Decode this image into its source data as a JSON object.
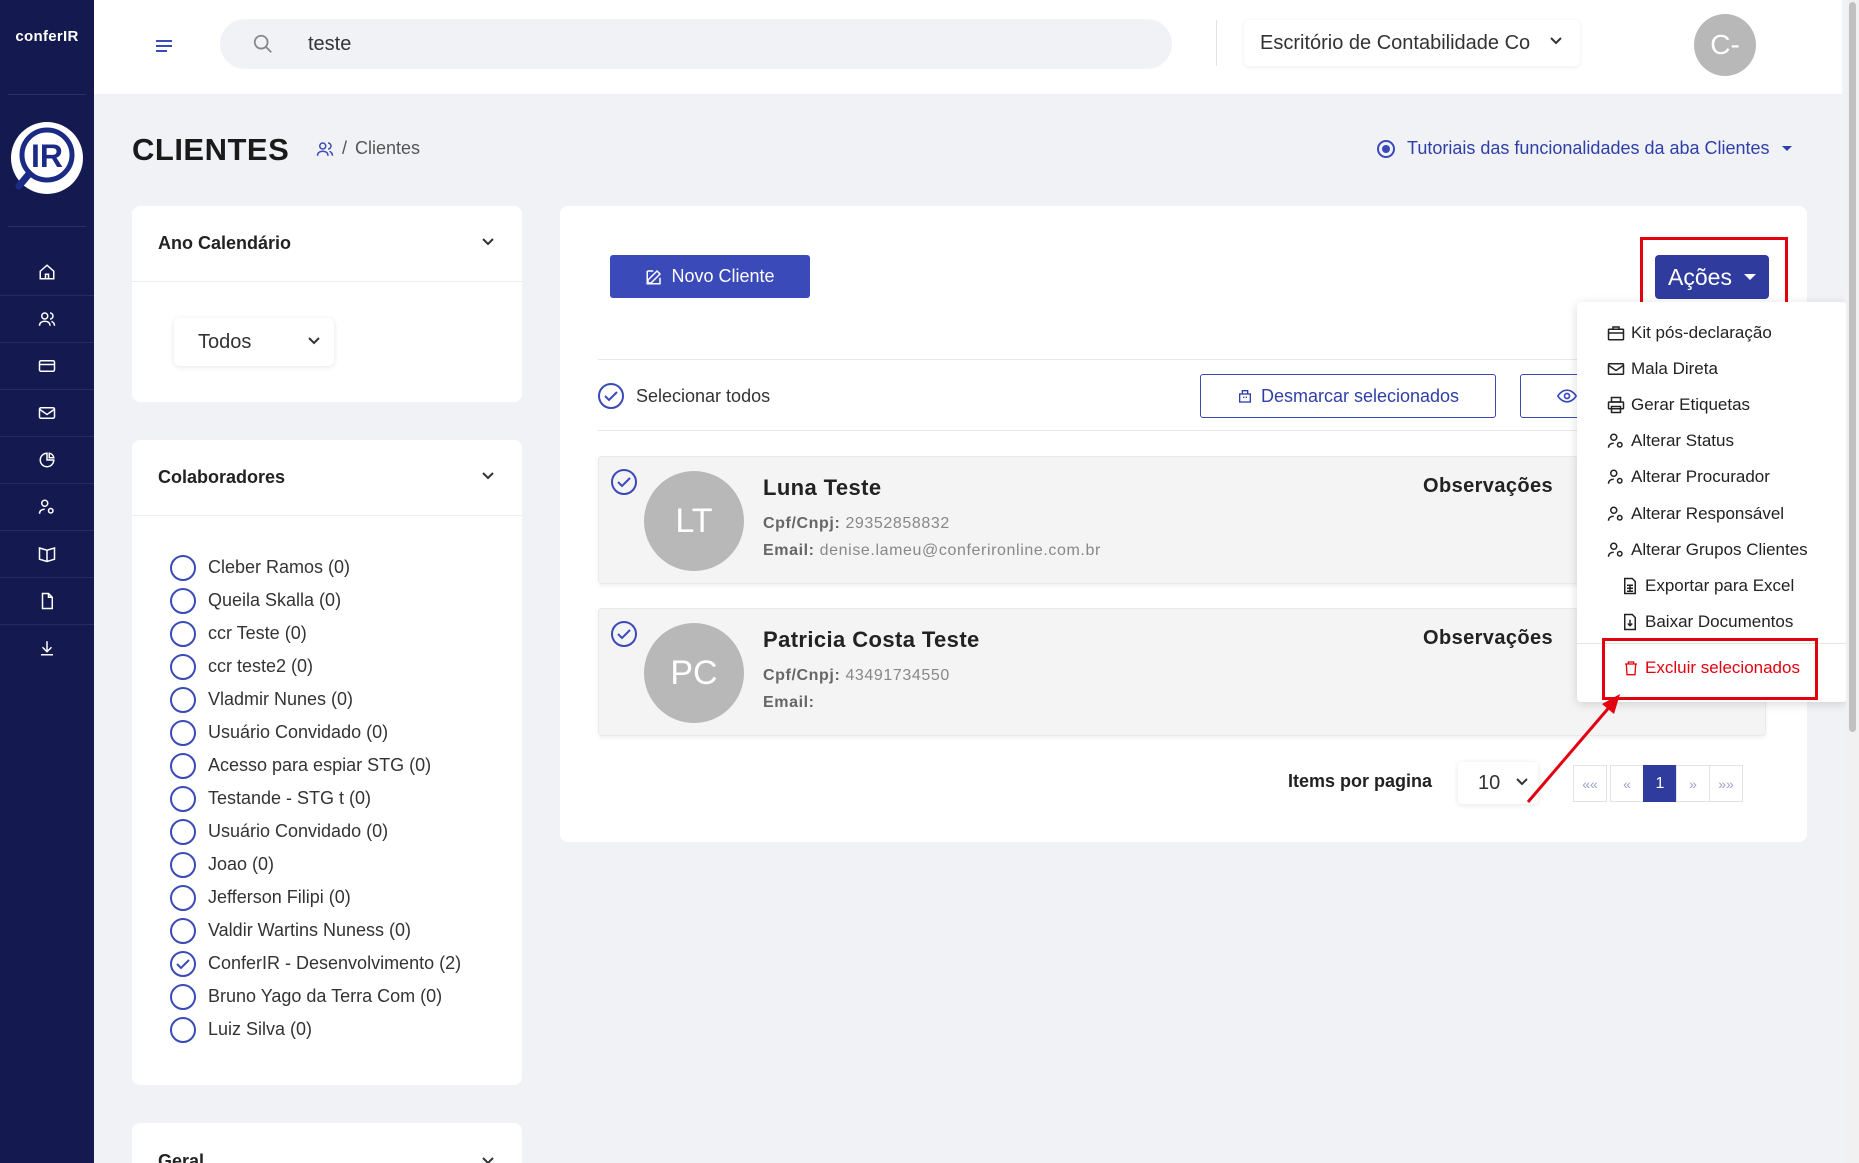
{
  "sidebar": {
    "brand_text": "conferIR",
    "logo_text": "IR",
    "nav": [
      {
        "id": "home",
        "icon": "home-icon"
      },
      {
        "id": "clientes",
        "icon": "users-icon"
      },
      {
        "id": "cards",
        "icon": "credit-card-icon"
      },
      {
        "id": "mail",
        "icon": "mail-icon"
      },
      {
        "id": "reports",
        "icon": "pie-chart-icon"
      },
      {
        "id": "user-settings",
        "icon": "user-gear-icon"
      },
      {
        "id": "book",
        "icon": "book-icon"
      },
      {
        "id": "documents",
        "icon": "document-icon"
      },
      {
        "id": "download",
        "icon": "download-icon"
      }
    ]
  },
  "topbar": {
    "search_value": "teste",
    "office_select": "Escritório de Contabilidade Co",
    "avatar_initials": "C-"
  },
  "header": {
    "title": "CLIENTES",
    "breadcrumb_sep": "/",
    "breadcrumb_current": "Clientes",
    "tutorials_label": "Tutoriais das funcionalidades da aba Clientes"
  },
  "filters": {
    "ano": {
      "title": "Ano Calendário",
      "selected": "Todos"
    },
    "colaboradores": {
      "title": "Colaboradores",
      "items": [
        {
          "label": "Cleber Ramos (0)",
          "checked": false
        },
        {
          "label": "Queila Skalla (0)",
          "checked": false
        },
        {
          "label": "ccr Teste (0)",
          "checked": false
        },
        {
          "label": "ccr teste2 (0)",
          "checked": false
        },
        {
          "label": "Vladmir Nunes (0)",
          "checked": false
        },
        {
          "label": "Usuário Convidado (0)",
          "checked": false
        },
        {
          "label": "Acesso para espiar STG (0)",
          "checked": false
        },
        {
          "label": "Testande - STG t (0)",
          "checked": false
        },
        {
          "label": "Usuário Convidado (0)",
          "checked": false
        },
        {
          "label": "Joao (0)",
          "checked": false
        },
        {
          "label": "Jefferson Filipi (0)",
          "checked": false
        },
        {
          "label": "Valdir Wartins Nuness (0)",
          "checked": false
        },
        {
          "label": "ConferIR - Desenvolvimento (2)",
          "checked": true
        },
        {
          "label": "Bruno Yago da Terra Com (0)",
          "checked": false
        },
        {
          "label": "Luiz Silva (0)",
          "checked": false
        }
      ]
    },
    "geral": {
      "title": "Geral"
    }
  },
  "toolbar": {
    "novo_cliente": "Novo Cliente",
    "acoes": "Ações",
    "selecionar_todos": "Selecionar todos",
    "desmarcar": "Desmarcar selecionados"
  },
  "clients": [
    {
      "initials": "LT",
      "name": "Luna Teste",
      "cpf_label": "Cpf/Cnpj:",
      "cpf": "29352858832",
      "email_label": "Email:",
      "email": "denise.lameu@conferironline.com.br",
      "obs_label": "Observações"
    },
    {
      "initials": "PC",
      "name": "Patricia Costa Teste",
      "cpf_label": "Cpf/Cnpj:",
      "cpf": "43491734550",
      "email_label": "Email:",
      "email": "",
      "obs_label": "Observações"
    }
  ],
  "pagination": {
    "items_label": "Items por pagina",
    "page_size": "10",
    "first": "««",
    "prev": "«",
    "current": "1",
    "next": "»",
    "last": "»»"
  },
  "actions_menu": {
    "items": [
      {
        "label": "Kit pós-declaração",
        "icon": "briefcase-icon"
      },
      {
        "label": "Mala Direta",
        "icon": "mail-send-icon"
      },
      {
        "label": "Gerar Etiquetas",
        "icon": "printer-icon"
      },
      {
        "label": "Alterar Status",
        "icon": "user-gear-icon"
      },
      {
        "label": "Alterar Procurador",
        "icon": "user-gear-icon"
      },
      {
        "label": "Alterar Responsável",
        "icon": "user-gear-icon"
      },
      {
        "label": "Alterar Grupos Clientes",
        "icon": "user-gear-icon"
      },
      {
        "label": "Exportar para Excel",
        "icon": "spreadsheet-icon"
      },
      {
        "label": "Baixar Documentos",
        "icon": "file-download-icon"
      }
    ],
    "delete": "Excluir selecionados"
  },
  "colors": {
    "sidebar": "#141a4f",
    "primary": "#3a4ab8",
    "highlight": "#e3000f"
  }
}
